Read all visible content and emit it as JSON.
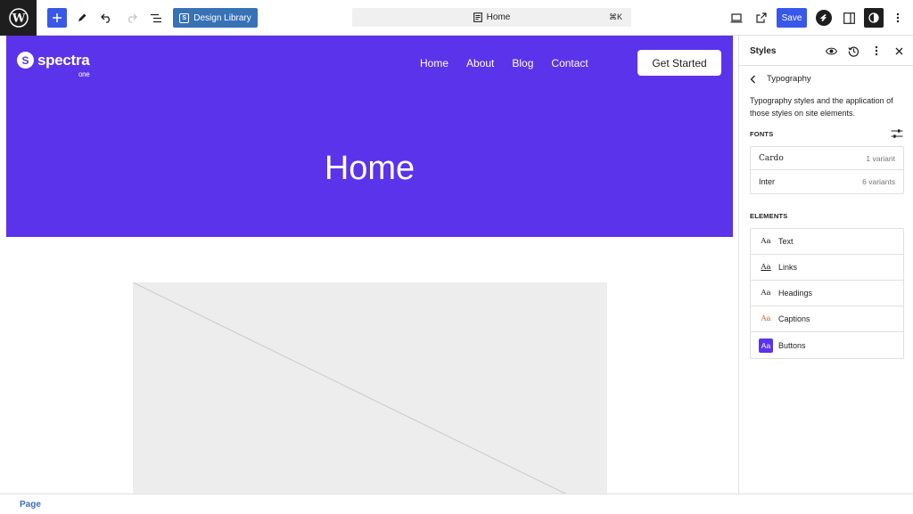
{
  "toolbar": {
    "design_library_label": "Design Library",
    "command_title": "Home",
    "command_shortcut": "⌘K",
    "save_label": "Save"
  },
  "site": {
    "logo_text": "spectra",
    "logo_sub": "one",
    "nav": [
      "Home",
      "About",
      "Blog",
      "Contact"
    ],
    "cta_label": "Get Started",
    "hero_title": "Home"
  },
  "footer": {
    "breadcrumb": "Page"
  },
  "panel": {
    "title": "Styles",
    "section_title": "Typography",
    "description": "Typography styles and the application of those styles on site elements.",
    "fonts_label": "FONTS",
    "fonts": [
      {
        "name": "Cardo",
        "variants": "1 variant"
      },
      {
        "name": "Inter",
        "variants": "6 variants"
      }
    ],
    "elements_label": "ELEMENTS",
    "elements": [
      {
        "preview": "Aa",
        "label": "Text"
      },
      {
        "preview": "Aa",
        "label": "Links"
      },
      {
        "preview": "Aa",
        "label": "Headings"
      },
      {
        "preview": "Aa",
        "label": "Captions"
      },
      {
        "preview": "Aa",
        "label": "Buttons"
      }
    ]
  },
  "colors": {
    "accent": "#3858e9",
    "brand": "#5b33ea",
    "caption_preview": "#e4572e"
  }
}
